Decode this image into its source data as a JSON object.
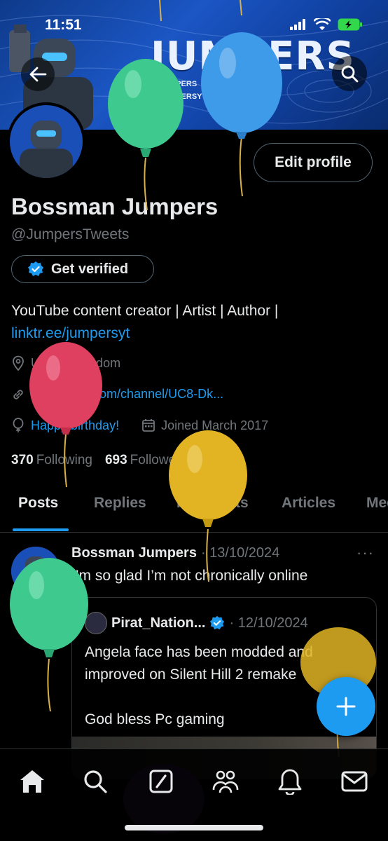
{
  "status_bar": {
    "time": "11:51"
  },
  "banner": {
    "title": "JUMPERS",
    "sub1": "JUMPERS",
    "sub2": "JUMPERSYT"
  },
  "profile": {
    "edit_label": "Edit profile",
    "name": "Bossman Jumpers",
    "handle": "@JumpersTweets",
    "verify_label": "Get verified",
    "bio_text": "YouTube content creator | Artist | Author |",
    "bio_link": "linktr.ee/jumpersyt",
    "location": "United Kingdom",
    "website": "m.youtube.com/channel/UC8-Dk...",
    "birthday": "Happy birthday!",
    "joined": "Joined March 2017",
    "following_count": "370",
    "following_label": "Following",
    "followers_count": "693",
    "followers_label": "Followers"
  },
  "tabs": [
    "Posts",
    "Replies",
    "Highlights",
    "Articles",
    "Media"
  ],
  "post": {
    "author": "Bossman Jumpers",
    "date": "· 13/10/2024",
    "more": "···",
    "text": "I’m so glad I’m not chronically online",
    "quote": {
      "author": "Pirat_Nation...",
      "date": "· 12/10/2024",
      "line1": "Angela face has been modded and",
      "line2": "improved on Silent Hill 2 remake",
      "line3": "God bless Pc gaming"
    }
  },
  "nav": [
    "home-icon",
    "search-icon",
    "grok-icon",
    "communities-icon",
    "notifications-icon",
    "messages-icon"
  ],
  "colors": {
    "accent": "#1d9bf0",
    "background": "#000000",
    "muted": "#71767b",
    "text": "#e7e9ea"
  }
}
